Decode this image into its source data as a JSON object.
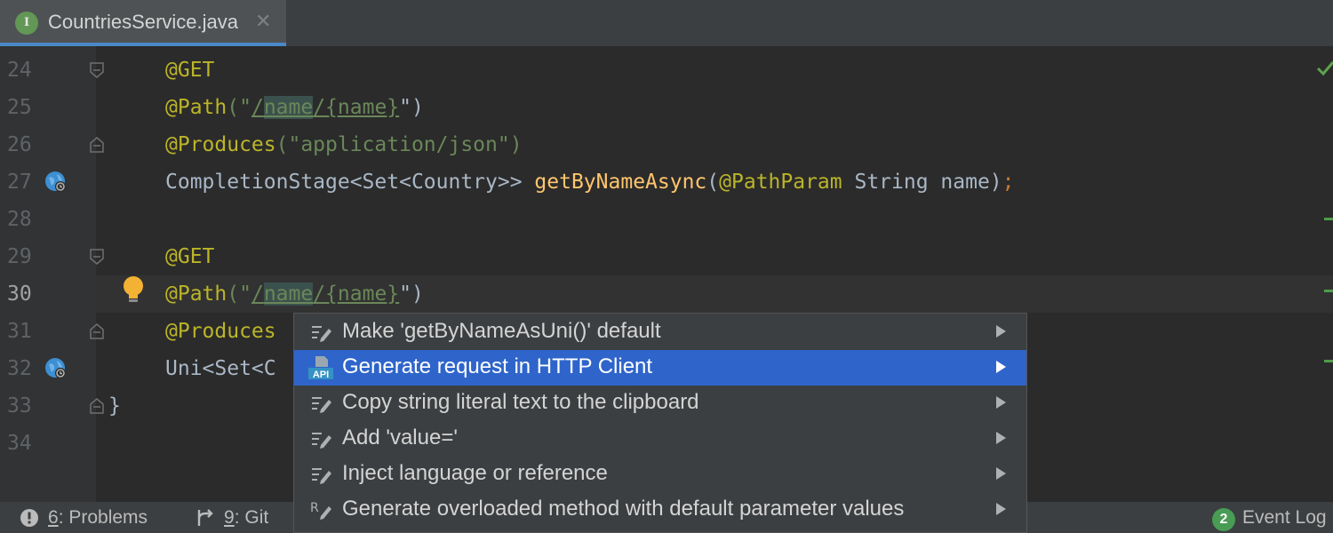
{
  "tab": {
    "icon_letter": "I",
    "filename": "CountriesService.java",
    "close_glyph": "✕"
  },
  "editor": {
    "lines": [
      {
        "num": "24"
      },
      {
        "num": "25"
      },
      {
        "num": "26"
      },
      {
        "num": "27"
      },
      {
        "num": "28"
      },
      {
        "num": "29"
      },
      {
        "num": "30"
      },
      {
        "num": "31"
      },
      {
        "num": "32"
      },
      {
        "num": "33"
      },
      {
        "num": "34"
      }
    ],
    "code": {
      "l24": "@GET",
      "l25_ann": "@Path",
      "l25_open": "(\"",
      "l25_p1": "/",
      "l25_p2": "name",
      "l25_p3": "/{",
      "l25_p4": "name",
      "l25_p5": "}",
      "l25_close": "\")",
      "l26_ann": "@Produces",
      "l26_rest": "(\"application/json\")",
      "l27_type": "CompletionStage<Set<Country>> ",
      "l27_meth": "getByNameAsync",
      "l27_open": "(",
      "l27_ann": "@PathParam",
      "l27_param": " String name)",
      "l27_semi": ";",
      "l29": "@GET",
      "l30_ann": "@Path",
      "l30_open": "(\"",
      "l30_p1": "/",
      "l30_p2": "name",
      "l30_p3": "/{",
      "l30_p4": "name",
      "l30_p5": "}",
      "l30_close": "\")",
      "l31_ann": "@Produces",
      "l32_type": "Uni<Set<C",
      "l33": "}"
    }
  },
  "popup": {
    "items": [
      {
        "label": "Make 'getByNameAsUni()' default",
        "icon": "intention-icon"
      },
      {
        "label": "Generate request in HTTP Client",
        "icon": "api-icon",
        "selected": true
      },
      {
        "label": "Copy string literal text to the clipboard",
        "icon": "intention-icon"
      },
      {
        "label": "Add 'value='",
        "icon": "intention-icon"
      },
      {
        "label": "Inject language or reference",
        "icon": "intention-icon"
      },
      {
        "label": "Generate overloaded method with default parameter values",
        "icon": "refactor-icon"
      }
    ],
    "api_icon_text": "API",
    "refactor_icon_text": "R"
  },
  "statusbar": {
    "problems_key": "6",
    "problems_label": ": Problems",
    "git_key": "9",
    "git_label": ": Git",
    "event_count": "2",
    "event_label": "Event Log"
  },
  "colors": {
    "accent": "#2f65ca",
    "annotation": "#bbb529",
    "string": "#6a8759",
    "method": "#ffc66d",
    "keyword": "#cc7832"
  }
}
